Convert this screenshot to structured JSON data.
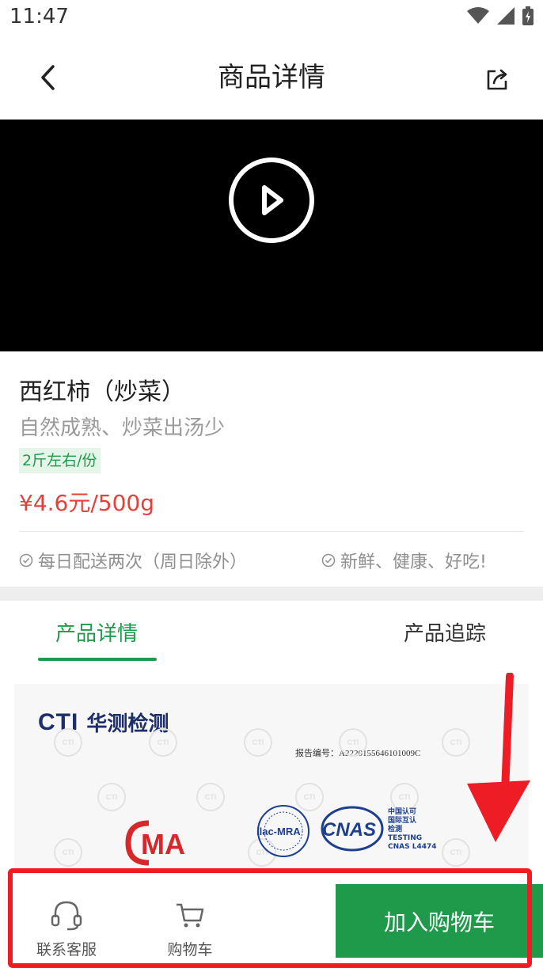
{
  "status_bar": {
    "time": "11:47"
  },
  "header": {
    "title": "商品详情"
  },
  "product": {
    "name": "西红柿（炒菜）",
    "subtitle": "自然成熟、炒菜出汤少",
    "spec": "2斤左右/份",
    "price": "¥4.6元/500g",
    "features": [
      "每日配送两次（周日除外）",
      "新鲜、健康、好吃!"
    ]
  },
  "tabs": [
    "产品详情",
    "产品追踪"
  ],
  "certificate": {
    "brand_en": "CTI",
    "brand_cn": "华测检测",
    "report_no": "报告编号：A2220155646101009C",
    "cma": "MA",
    "ilac": "ilac-MRA",
    "cnas": "CNAS",
    "cnas_cn_1": "中国认可",
    "cnas_cn_2": "国际互认",
    "cnas_cn_3": "检测",
    "cnas_en_1": "TESTING",
    "cnas_en_2": "CNAS L4474",
    "watermark": "CTI"
  },
  "bottom_bar": {
    "service_label": "联系客服",
    "cart_label": "购物车",
    "add_to_cart": "加入购物车"
  },
  "colors": {
    "brand_green": "#1f9a4a",
    "price_red": "#e5403b",
    "highlight_red": "#ee1c25"
  },
  "icons": [
    "back-icon",
    "share-icon",
    "play-icon",
    "check-circle-icon",
    "headset-icon",
    "cart-icon",
    "wifi-icon",
    "signal-icon",
    "battery-icon"
  ]
}
